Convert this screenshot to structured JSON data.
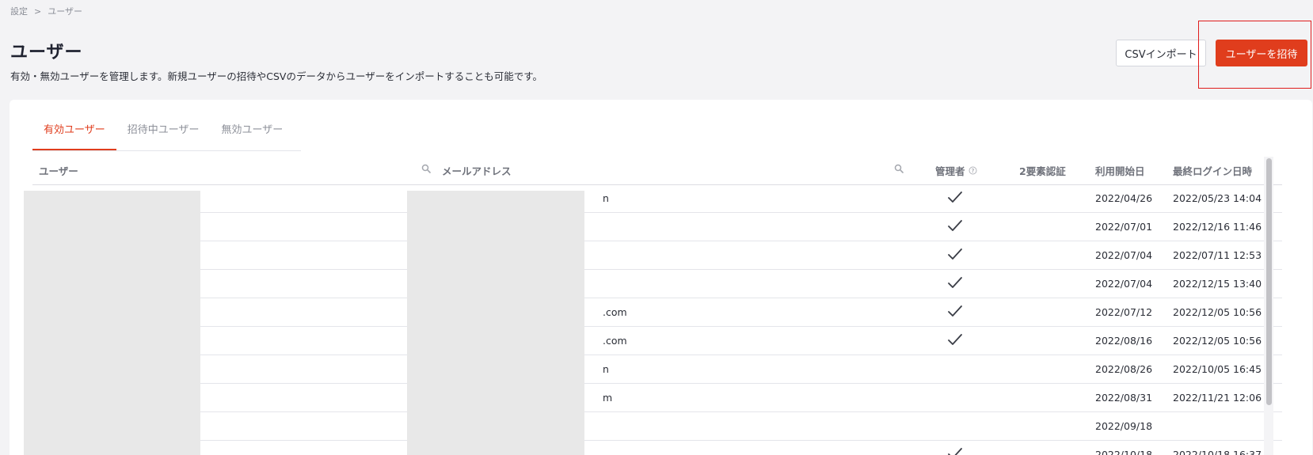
{
  "breadcrumb": {
    "items": [
      "設定",
      "ユーザー"
    ],
    "separator": ">"
  },
  "header": {
    "title": "ユーザー",
    "description": "有効・無効ユーザーを管理します。新規ユーザーの招待やCSVのデータからユーザーをインポートすることも可能です。",
    "import_label": "CSVインポート",
    "invite_label": "ユーザーを招待"
  },
  "tabs": [
    {
      "label": "有効ユーザー",
      "active": true
    },
    {
      "label": "招待中ユーザー",
      "active": false
    },
    {
      "label": "無効ユーザー",
      "active": false
    }
  ],
  "table": {
    "columns": {
      "user": "ユーザー",
      "email": "メールアドレス",
      "admin": "管理者",
      "two_factor": "2要素認証",
      "start_date": "利用開始日",
      "last_login": "最終ログイン日時"
    },
    "rows": [
      {
        "email_tail": "n",
        "admin": true,
        "start_date": "2022/04/26",
        "last_login": "2022/05/23 14:04"
      },
      {
        "email_tail": "",
        "admin": true,
        "start_date": "2022/07/01",
        "last_login": "2022/12/16 11:46"
      },
      {
        "email_tail": "",
        "admin": true,
        "start_date": "2022/07/04",
        "last_login": "2022/07/11 12:53"
      },
      {
        "email_tail": "",
        "admin": true,
        "start_date": "2022/07/04",
        "last_login": "2022/12/15 13:40"
      },
      {
        "email_tail": ".com",
        "admin": true,
        "start_date": "2022/07/12",
        "last_login": "2022/12/05 10:56"
      },
      {
        "email_tail": ".com",
        "admin": true,
        "start_date": "2022/08/16",
        "last_login": "2022/12/05 10:56"
      },
      {
        "email_tail": "n",
        "admin": false,
        "start_date": "2022/08/26",
        "last_login": "2022/10/05 16:45"
      },
      {
        "email_tail": "m",
        "admin": false,
        "start_date": "2022/08/31",
        "last_login": "2022/11/21 12:06"
      },
      {
        "email_tail": "",
        "admin": false,
        "start_date": "2022/09/18",
        "last_login": ""
      },
      {
        "email_tail": "",
        "admin": true,
        "start_date": "2022/10/18",
        "last_login": "2022/10/18 16:37"
      }
    ]
  },
  "colors": {
    "accent": "#e03d1d",
    "highlight": "#e01c1c"
  }
}
